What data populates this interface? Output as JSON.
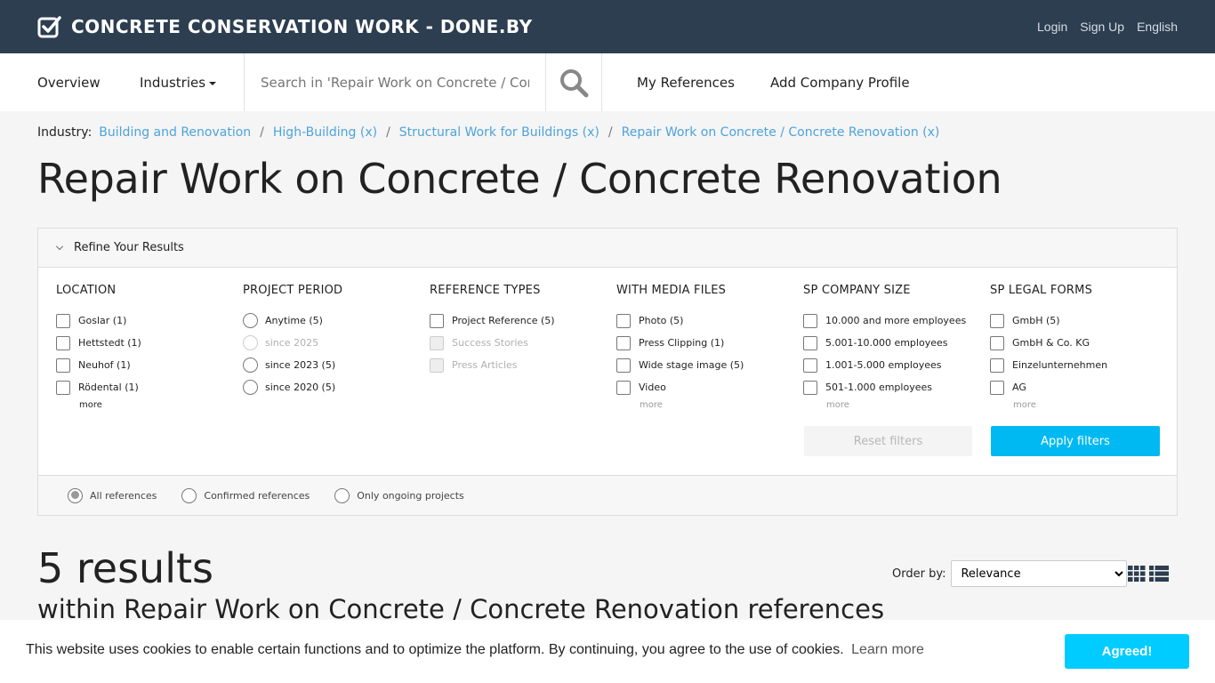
{
  "header": {
    "brand": "CONCRETE CONSERVATION WORK - DONE.BY",
    "links": [
      "Login",
      "Sign Up",
      "English"
    ]
  },
  "nav": {
    "overview": "Overview",
    "industries": "Industries",
    "search_placeholder": "Search in 'Repair Work on Concrete / Con...",
    "my_references": "My References",
    "add_company": "Add Company Profile"
  },
  "breadcrumb": {
    "label": "Industry:",
    "items": [
      "Building and Renovation",
      "High-Building (x)",
      "Structural Work for Buildings (x)",
      "Repair Work on Concrete / Concrete Renovation (x)"
    ],
    "separator": "/"
  },
  "page_title": "Repair Work on Concrete / Concrete Renovation",
  "filters": {
    "panel_title": "Refine Your Results",
    "location": {
      "title": "LOCATION",
      "options": [
        "Goslar (1)",
        "Hettstedt (1)",
        "Neuhof (1)",
        "Rödental (1)"
      ],
      "more": "more"
    },
    "period": {
      "title": "PROJECT PERIOD",
      "options": [
        "Anytime (5)",
        "since 2025",
        "since 2023 (5)",
        "since 2020 (5)"
      ]
    },
    "ref_types": {
      "title": "REFERENCE TYPES",
      "options": [
        "Project Reference (5)",
        "Success Stories",
        "Press Articles"
      ]
    },
    "media": {
      "title": "WITH MEDIA FILES",
      "options": [
        "Photo (5)",
        "Press Clipping (1)",
        "Wide stage image (5)",
        "Video"
      ],
      "more": "more"
    },
    "company_size": {
      "title": "SP COMPANY SIZE",
      "options": [
        "10.000 and more employees",
        "5.001-10.000 employees",
        "1.001-5.000 employees",
        "501-1.000 employees"
      ],
      "more": "more"
    },
    "legal_forms": {
      "title": "SP LEGAL FORMS",
      "options": [
        "GmbH (5)",
        "GmbH & Co. KG",
        "Einzelunternehmen",
        "AG"
      ],
      "more": "more"
    },
    "reset": "Reset filters",
    "apply": "Apply filters",
    "scope": [
      "All references",
      "Confirmed references",
      "Only ongoing projects"
    ],
    "apply_color": "#00b9f2"
  },
  "results": {
    "count": "5 results",
    "subtitle": "within Repair Work on Concrete / Concrete Renovation references",
    "order_label": "Order by:",
    "order_value": "Relevance"
  },
  "cookie": {
    "message": "This website uses cookies to enable certain functions and to optimize the platform. By continuing, you agree to the use of cookies.",
    "learn_more": "Learn more",
    "button": "Agreed!",
    "button_color": "#00ccff"
  }
}
